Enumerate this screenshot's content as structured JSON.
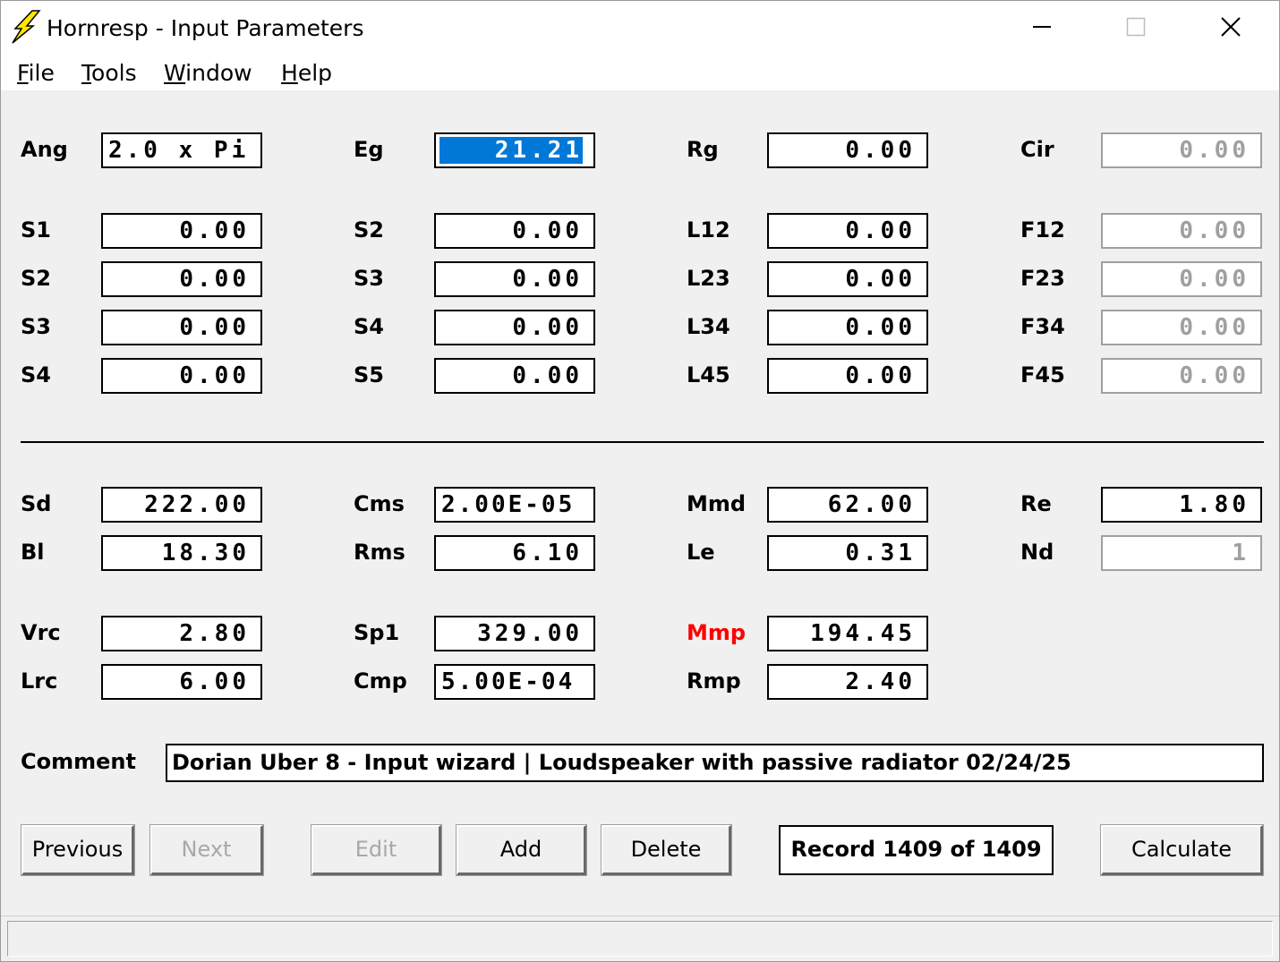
{
  "window": {
    "title": "Hornresp - Input Parameters"
  },
  "menu": [
    "File",
    "Tools",
    "Window",
    "Help"
  ],
  "params": {
    "Ang": "2.0 x Pi",
    "Eg": "21.21",
    "Rg": "0.00",
    "Cir": "0.00",
    "S1a": "0.00",
    "S2b": "0.00",
    "L12": "0.00",
    "F12": "0.00",
    "S2a": "0.00",
    "S3b": "0.00",
    "L23": "0.00",
    "F23": "0.00",
    "S3a": "0.00",
    "S4b": "0.00",
    "L34": "0.00",
    "F34": "0.00",
    "S4a": "0.00",
    "S5b": "0.00",
    "L45": "0.00",
    "F45": "0.00",
    "Sd": "222.00",
    "Cms": "2.00E-05",
    "Mmd": "62.00",
    "Re": "1.80",
    "Bl": "18.30",
    "Rms": "6.10",
    "Le": "0.31",
    "Nd": "1",
    "Vrc": "2.80",
    "Sp1": "329.00",
    "Mmp": "194.45",
    "Lrc": "6.00",
    "Cmp": "5.00E-04",
    "Rmp": "2.40"
  },
  "labels": {
    "Ang": "Ang",
    "Eg": "Eg",
    "Rg": "Rg",
    "Cir": "Cir",
    "S1a": "S1",
    "S2b": "S2",
    "L12": "L12",
    "F12": "F12",
    "S2a": "S2",
    "S3b": "S3",
    "L23": "L23",
    "F23": "F23",
    "S3a": "S3",
    "S4b": "S4",
    "L34": "L34",
    "F34": "F34",
    "S4a": "S4",
    "S5b": "S5",
    "L45": "L45",
    "F45": "F45",
    "Sd": "Sd",
    "Cms": "Cms",
    "Mmd": "Mmd",
    "Re": "Re",
    "Bl": "Bl",
    "Rms": "Rms",
    "Le": "Le",
    "Nd": "Nd",
    "Vrc": "Vrc",
    "Sp1": "Sp1",
    "Mmp": "Mmp",
    "Lrc": "Lrc",
    "Cmp": "Cmp",
    "Rmp": "Rmp",
    "Comment": "Comment"
  },
  "comment": "Dorian Uber 8 - Input wizard | Loudspeaker with passive radiator 02/24/25",
  "buttons": {
    "previous": "Previous",
    "next": "Next",
    "edit": "Edit",
    "add": "Add",
    "delete": "Delete",
    "calculate": "Calculate"
  },
  "record": "Record 1409 of 1409",
  "colors": {
    "highlight_label": "#ff0000",
    "selection": "#0078d7"
  }
}
